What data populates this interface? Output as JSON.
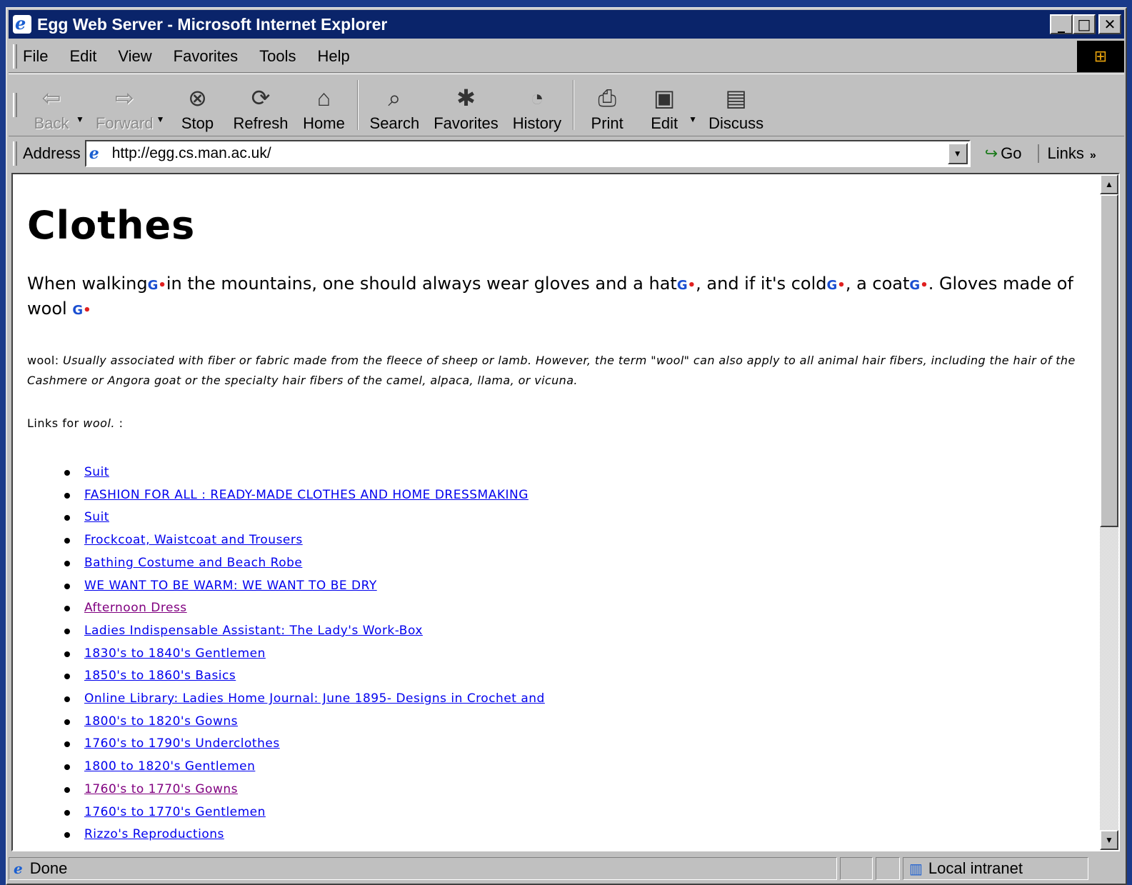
{
  "window": {
    "title": "Egg Web Server - Microsoft Internet Explorer",
    "min_label": "_",
    "max_label": "□",
    "close_label": "✕"
  },
  "menu": [
    "File",
    "Edit",
    "View",
    "Favorites",
    "Tools",
    "Help"
  ],
  "toolbar": {
    "back": "Back",
    "forward": "Forward",
    "stop": "Stop",
    "refresh": "Refresh",
    "home": "Home",
    "search": "Search",
    "favorites": "Favorites",
    "history": "History",
    "print": "Print",
    "edit": "Edit",
    "discuss": "Discuss"
  },
  "address": {
    "label": "Address",
    "url": "http://egg.cs.man.ac.uk/",
    "go": "Go",
    "links": "Links"
  },
  "page": {
    "heading": "Clothes",
    "intro": {
      "part1": "When walking",
      "part2": "in the mountains, one should always wear gloves and a hat",
      "part3": ", and if it's cold",
      "part4": ", a coat",
      "part5": ". Gloves made of wool"
    },
    "definition": {
      "term": "wool:",
      "text": "Usually associated with fiber or fabric made from the fleece of sheep or lamb. However, the term \"wool\" can also apply to all animal hair fibers, including the hair of the Cashmere or Angora goat or the specialty hair fibers of the camel, alpaca, llama, or vicuna."
    },
    "links_for": {
      "prefix": "Links for",
      "term": "wool.",
      "suffix": ":"
    },
    "links": [
      {
        "text": "Suit",
        "visited": false
      },
      {
        "text": "FASHION FOR ALL : READY-MADE CLOTHES AND HOME DRESSMAKING",
        "visited": false
      },
      {
        "text": "Suit",
        "visited": false
      },
      {
        "text": "Frockcoat, Waistcoat and Trousers",
        "visited": false
      },
      {
        "text": "Bathing Costume and Beach Robe",
        "visited": false
      },
      {
        "text": "WE WANT TO BE WARM: WE WANT TO BE DRY",
        "visited": false
      },
      {
        "text": "Afternoon Dress",
        "visited": true
      },
      {
        "text": "Ladies Indispensable Assistant: The Lady's Work-Box",
        "visited": false
      },
      {
        "text": "1830's to 1840's Gentlemen",
        "visited": false
      },
      {
        "text": "1850's to 1860's Basics",
        "visited": false
      },
      {
        "text": "Online Library: Ladies Home Journal: June 1895- Designs in Crochet and",
        "visited": false
      },
      {
        "text": "1800's to 1820's Gowns",
        "visited": false
      },
      {
        "text": "1760's to 1790's Underclothes",
        "visited": false
      },
      {
        "text": "1800 to 1820's Gentlemen",
        "visited": false
      },
      {
        "text": "1760's to 1770's Gowns",
        "visited": true
      },
      {
        "text": "1760's to 1770's Gentlemen",
        "visited": false
      },
      {
        "text": "Rizzo's Reproductions",
        "visited": false
      }
    ]
  },
  "status": {
    "text": "Done",
    "zone": "Local intranet"
  },
  "colors": {
    "link": "#0000ee",
    "visited": "#800080",
    "titlebar": "#0a246a"
  }
}
